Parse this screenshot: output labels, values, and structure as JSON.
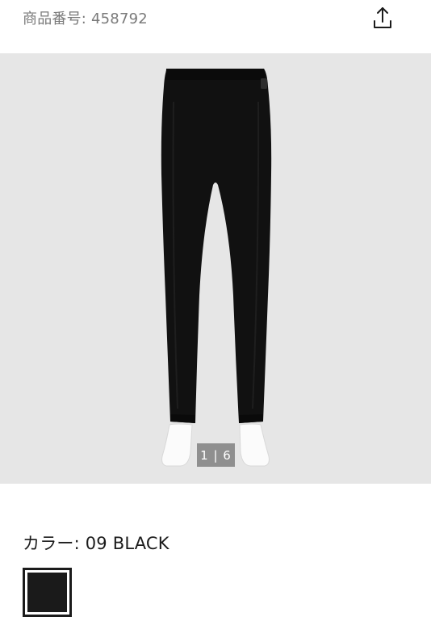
{
  "header": {
    "product_code": "商品番号: 458792",
    "share_icon": "share-upload-icon"
  },
  "gallery": {
    "counter": "1 | 6",
    "current": 1,
    "total": 6,
    "background_color": "#e6e6e6",
    "product_color": "#111111"
  },
  "color_section": {
    "label": "カラー: 09 BLACK",
    "swatches": [
      {
        "color": "#1a1a1a",
        "selected": true
      }
    ]
  }
}
